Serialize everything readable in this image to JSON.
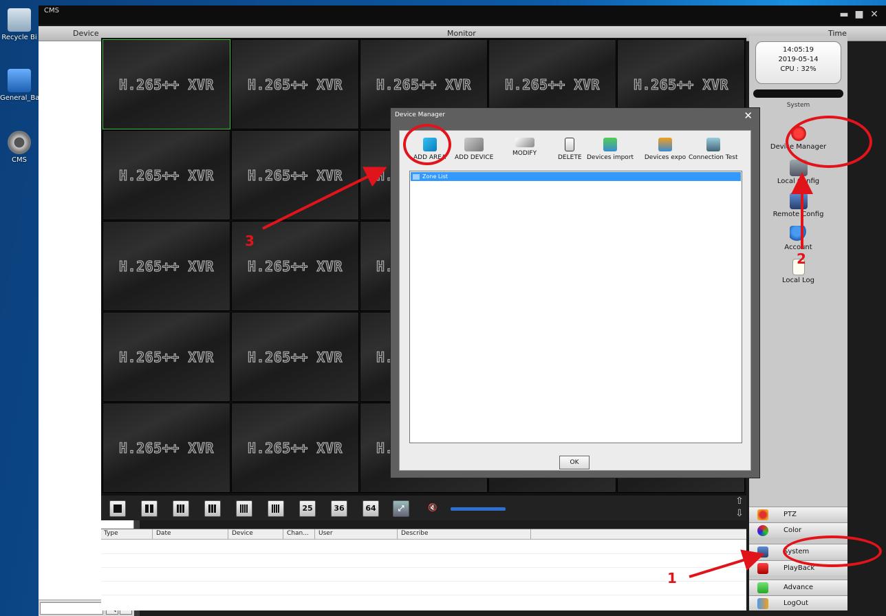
{
  "desktop": {
    "icons": [
      {
        "label": "Recycle Bi",
        "icon": "recycle-bin-icon"
      },
      {
        "label": "General_Ba",
        "icon": "computer-disk-icon"
      },
      {
        "label": "CMS",
        "icon": "webcam-icon"
      }
    ]
  },
  "window": {
    "title": "CMS",
    "minimize_glyph": "▬",
    "maximize_glyph": "■",
    "close_glyph": "✕"
  },
  "headers": {
    "device": "Device",
    "monitor": "Monitor",
    "time": "Time"
  },
  "monitor": {
    "watermark": "H.265++ XVR"
  },
  "search": {
    "search_glyph": "🔍",
    "refresh_glyph": "C"
  },
  "layout_buttons": [
    {
      "name": "layout-1",
      "label": ""
    },
    {
      "name": "layout-4",
      "label": ""
    },
    {
      "name": "layout-6",
      "label": ""
    },
    {
      "name": "layout-9",
      "label": ""
    },
    {
      "name": "layout-16",
      "label": ""
    },
    {
      "name": "layout-20",
      "label": ""
    },
    {
      "name": "layout-25",
      "label": "25"
    },
    {
      "name": "layout-36",
      "label": "36"
    },
    {
      "name": "layout-64",
      "label": "64"
    }
  ],
  "log_table": {
    "columns": [
      "Type",
      "Date",
      "Device",
      "Chan...",
      "User",
      "Describe"
    ]
  },
  "right_panel": {
    "clock": {
      "time": "14:05:19",
      "date": "2019-05-14",
      "cpu": "CPU : 32%"
    },
    "section_label": "System",
    "system_items": [
      "Device Manager",
      "Local Config",
      "Remote Config",
      "Account",
      "Local Log"
    ],
    "nav_buttons": [
      "PTZ",
      "Color",
      "System",
      "PlayBack",
      "Advance",
      "LogOut"
    ]
  },
  "device_manager": {
    "title": "Device Manager",
    "close_glyph": "✕",
    "tools": [
      "ADD AREA",
      "ADD DEVICE",
      "MODIFY",
      "DELETE",
      "Devices import",
      "Devices expo",
      "Connection Test"
    ],
    "zone_list_label": "Zone List",
    "ok_label": "OK"
  },
  "annotations": {
    "step1": "1",
    "step2": "2",
    "step3": "3",
    "color": "#e2141b"
  }
}
